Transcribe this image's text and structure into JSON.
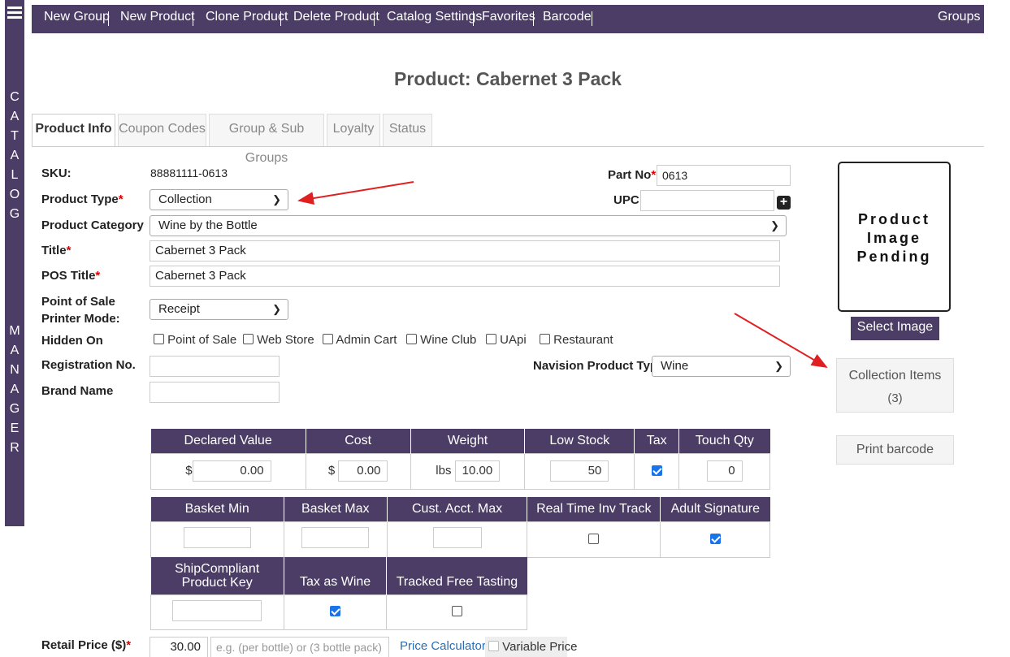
{
  "sidebar": {
    "section_a": [
      "C",
      "A",
      "T",
      "A",
      "L",
      "O",
      "G"
    ],
    "section_b": [
      "M",
      "A",
      "N",
      "A",
      "G",
      "E",
      "R"
    ]
  },
  "topnav": {
    "new_group": "New Group",
    "new_product": "New Product",
    "clone_product": "Clone Product",
    "delete_product": "Delete Product",
    "catalog_settings": "Catalog Settings",
    "favorites": "Favorites",
    "barcode": "Barcode",
    "groups": "Groups"
  },
  "page": {
    "title": "Product: Cabernet 3 Pack"
  },
  "tabs": [
    "Product Info",
    "Coupon Codes",
    "Group & Sub Groups",
    "Loyalty",
    "Status"
  ],
  "form": {
    "sku_label": "SKU:",
    "sku_value": "88881111-0613",
    "product_type_label": "Product Type",
    "product_type_value": "Collection",
    "product_category_label": "Product Category",
    "product_category_value": "Wine by the Bottle",
    "title_label": "Title",
    "title_value": "Cabernet 3 Pack",
    "pos_title_label": "POS Title",
    "pos_title_value": "Cabernet 3 Pack",
    "pos_printer_label_1": "Point of Sale",
    "pos_printer_label_2": "Printer Mode:",
    "pos_printer_value": "Receipt",
    "hidden_on_label": "Hidden On",
    "hidden_on_options": [
      "Point of Sale",
      "Web Store",
      "Admin Cart",
      "Wine Club",
      "UApi",
      "Restaurant"
    ],
    "registration_label": "Registration No.",
    "brand_label": "Brand Name",
    "part_no_label": "Part No",
    "part_no_value": "0613",
    "upc_label": "UPC",
    "navision_label": "Navision Product Type",
    "navision_value": "Wine",
    "required_mark": "*"
  },
  "image_panel": {
    "line1": "Product",
    "line2": "Image",
    "line3": "Pending",
    "select_image": "Select Image",
    "collection_items": "Collection Items",
    "collection_count": "(3)",
    "print_barcode": "Print barcode"
  },
  "table1": {
    "headers": [
      "Declared Value",
      "Cost",
      "Weight",
      "Low Stock",
      "Tax",
      "Touch Qty"
    ],
    "currency": "$",
    "weight_unit": "lbs",
    "declared_value": "0.00",
    "cost": "0.00",
    "weight": "10.00",
    "low_stock": "50",
    "touch_qty": "0",
    "tax_checked": true
  },
  "table2": {
    "headers": [
      "Basket Min",
      "Basket Max",
      "Cust. Acct. Max",
      "Real Time Inv Track",
      "Adult Signature"
    ],
    "real_time_checked": false,
    "adult_signature_checked": true
  },
  "table3": {
    "header_ship_1": "ShipCompliant",
    "header_ship_2": "Product Key",
    "header_tax_wine": "Tax as Wine",
    "header_free_tasting": "Tracked Free Tasting",
    "tax_as_wine_checked": true,
    "free_tasting_checked": false
  },
  "retail": {
    "label": "Retail Price ($)",
    "value": "30.00",
    "placeholder": "e.g. (per bottle) or (3 bottle pack)",
    "price_calculator": "Price Calculator",
    "variable_price": "Variable Price"
  },
  "colors": {
    "brand": "#4b3d65",
    "annotation_arrow": "#e02020",
    "link": "#2a6cb5"
  }
}
